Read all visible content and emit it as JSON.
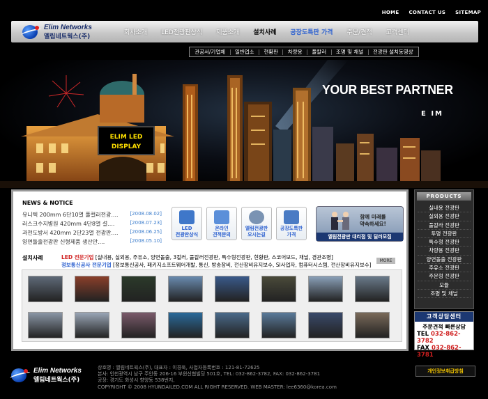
{
  "top_links": [
    "HOME",
    "CONTACT US",
    "SITEMAP"
  ],
  "brand": {
    "en": "Elim Networks",
    "ko": "엘림네트웍스(주)"
  },
  "main_nav": [
    "회사소개",
    "LED전광판상식",
    "제품소개",
    "설치사례",
    "공장도특판 가격",
    "주문/견적",
    "고객센터"
  ],
  "sub_nav": [
    "관공서/기업체",
    "일반업소",
    "현황판",
    "차량용",
    "풀칼러",
    "조명 및 채널",
    "전광판 설치동영상"
  ],
  "hero": {
    "tagline": "YOUR BEST PARTNER",
    "sub": "E IM",
    "sign_line1": "ELIM LED",
    "sign_line2": "DISPLAY"
  },
  "news": {
    "title": "NEWS & NOTICE",
    "items": [
      {
        "text": "유니텍 200mm 6단10열 풀컬러전광....",
        "date": "[2008.08.02]"
      },
      {
        "text": "러스크수지병원 420mm 4단8열 설....",
        "date": "[2008.07.23]"
      },
      {
        "text": "과천도방서 420mm 2단23열 전광판....",
        "date": "[2008.06.25]"
      },
      {
        "text": "양면돌출전광판 신형제품 생산안....",
        "date": "[2008.05.10]"
      }
    ]
  },
  "quick": [
    {
      "label1": "LED",
      "label2": "전광판상식",
      "icon_color": "#3f77c9",
      "icon": "book-icon"
    },
    {
      "label1": "온라인",
      "label2": "견적문의",
      "icon_color": "#5b8fd9",
      "icon": "monitor-icon"
    },
    {
      "label1": "엘림전광판",
      "label2": "오시는길",
      "icon_color": "#7a93b3",
      "icon": "magnifier-icon"
    },
    {
      "label1": "공장도특판",
      "label2": "가격",
      "icon_color": "#4a7bc4",
      "icon": "wrench-icon"
    }
  ],
  "recruit": {
    "msg1": "함께 미래를",
    "msg2": "약속하세요!",
    "bar": "엘림전광판 대리점 및 딜러모집"
  },
  "install": {
    "title": "설치사례",
    "line1_head": "LED 전문기업",
    "line1": "[실내용, 실외용, 주유소, 양면돌출, 3컬러, 풀칼러전광판, 특수형전광판, 현황판, 스코어보드, 채널, 경관조명]",
    "line2_head": "정보통신공사 전문기업",
    "line2": "[정보통신공사, 패키지소프트웨어개발, 통신, 방송장비, 전산장비유지보수, SI사업자, 컴퓨터시스템, 전산장비유지보수]",
    "more": "MORE"
  },
  "thumb_colors": [
    [
      "#5f6a78",
      "#8a3f2a",
      "#2b3a2a",
      "#6a8bb0",
      "#3a5a8a",
      "#4a4a3a",
      "#8aa0b8",
      "#6a7a8a"
    ],
    [
      "#8a96a6",
      "#9aa6b6",
      "#7a5a6a",
      "#2a6a9a",
      "#4a6a8a",
      "#5a7a9a",
      "#3a4a6a",
      "#7a6a5a"
    ]
  ],
  "products": {
    "title": "PRODUCTS",
    "items": [
      "실내용 전광판",
      "실외용 전광판",
      "풀칼라 전광판",
      "투명 전광판",
      "특수형 전광판",
      "차량용 전광판",
      "양면돌출 전광판",
      "주유소 전광판",
      "주문형 전광판",
      "모듈",
      "조명 및 채널"
    ]
  },
  "counsel": {
    "title": "고객상담센터",
    "sub": "주문견적 빠른상담",
    "tel_label": "TEL",
    "tel": "032-862-3782",
    "fax_label": "FAX",
    "fax": "032-862-3781"
  },
  "footer": {
    "lines": [
      "상호명 : 엘림네트웍스(주), 대표자 : 이경욱, 사업자등록번호 : 121-81-72625",
      "본사: 인천광역시 남구 주안동 206-16 부윈신협빌딩 501호, TEL: 032-862-3782, FAX: 032-862-3781",
      "공장: 경기도 화성시 향양동 538번지,",
      "COPYRIGHT © 2008 HYUNDAILED.COM ALL RIGHT RESERVED. WEB MASTER: lee6360@korea.com"
    ],
    "privacy": "개인정보취급방침"
  },
  "colors": {
    "accent_blue": "#2a5fcf",
    "date_blue": "#3c7dcc",
    "navy": "#1c3872",
    "red": "#d02020"
  }
}
